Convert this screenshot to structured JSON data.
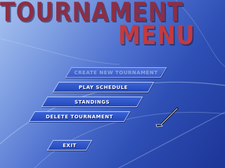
{
  "title": {
    "line1": "TOURNAMENT",
    "line2": "MENU"
  },
  "menu": {
    "create_new_tournament": "CREATE NEW TOURNAMENT",
    "play_schedule": "PLAY SCHEDULE",
    "standings": "STANDINGS",
    "delete_tournament": "DELETE TOURNAMENT",
    "exit": "EXIT"
  },
  "colors": {
    "title_line1": "#8a2f45",
    "title_line2": "#c43a3e",
    "button_fill": "#2548b8",
    "button_border": "#b9ccf5",
    "button_text": "#ffffff",
    "button_text_disabled": "#8fa6dd"
  },
  "icons": {
    "cursor": "hockey-stick-icon"
  }
}
